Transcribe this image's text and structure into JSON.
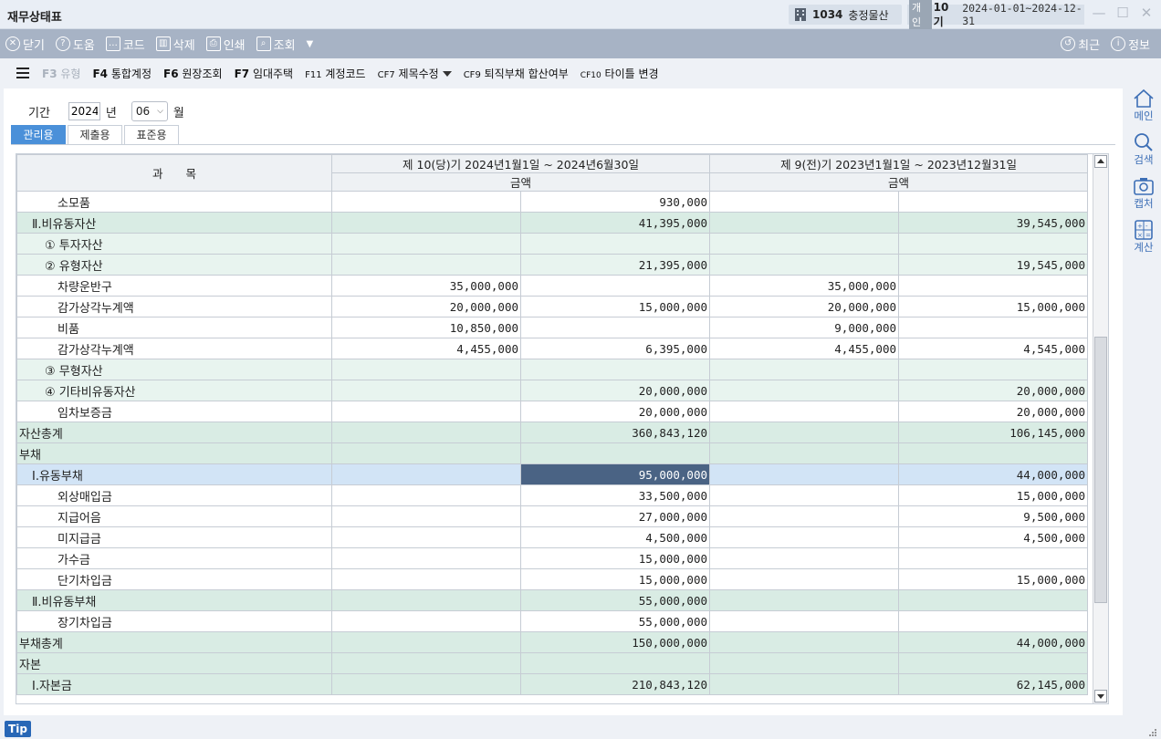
{
  "window": {
    "title": "재무상태표",
    "company_code": "1034",
    "company_name": "충정물산",
    "entity_type": "개인",
    "term": "10기",
    "period_range": "2024-01-01~2024-12-31"
  },
  "toolbar": {
    "close": "닫기",
    "help": "도움",
    "code": "코드",
    "delete": "삭제",
    "print": "인쇄",
    "query": "조회",
    "recent": "최근",
    "info": "정보"
  },
  "fkeys": {
    "f3_key": "F3",
    "f3_label": "유형",
    "f4_key": "F4",
    "f4_label": "통합계정",
    "f6_key": "F6",
    "f6_label": "원장조회",
    "f7_key": "F7",
    "f7_label": "임대주택",
    "f11_key": "F11",
    "f11_label": "계정코드",
    "cf7_key": "CF7",
    "cf7_label": "제목수정",
    "cf9_key": "CF9",
    "cf9_label": "퇴직부채 합산여부",
    "cf10_key": "CF10",
    "cf10_label": "타이틀 변경"
  },
  "filter": {
    "period_label": "기간",
    "year": "2024",
    "year_unit": "년",
    "month": "06",
    "month_unit": "월"
  },
  "tabs": [
    "관리용",
    "제출용",
    "표준용"
  ],
  "table": {
    "header_subject": "과　　목",
    "header_current": "제 10(당)기 2024년1월1일 ~ 2024년6월30일",
    "header_prior": "제 9(전)기 2023년1월1일 ~ 2023년12월31일",
    "amount_label_current": "금액",
    "amount_label_prior": "금액",
    "rows": [
      {
        "label": "소모품",
        "c1": "",
        "c2": "930,000",
        "p1": "",
        "p2": ""
      },
      {
        "label": "Ⅱ.비유동자산",
        "c1": "",
        "c2": "41,395,000",
        "p1": "",
        "p2": "39,545,000"
      },
      {
        "label": "① 투자자산",
        "c1": "",
        "c2": "",
        "p1": "",
        "p2": ""
      },
      {
        "label": "② 유형자산",
        "c1": "",
        "c2": "21,395,000",
        "p1": "",
        "p2": "19,545,000"
      },
      {
        "label": "차량운반구",
        "c1": "35,000,000",
        "c2": "",
        "p1": "35,000,000",
        "p2": ""
      },
      {
        "label": "감가상각누계액",
        "c1": "20,000,000",
        "c2": "15,000,000",
        "p1": "20,000,000",
        "p2": "15,000,000"
      },
      {
        "label": "비품",
        "c1": "10,850,000",
        "c2": "",
        "p1": "9,000,000",
        "p2": ""
      },
      {
        "label": "감가상각누계액",
        "c1": "4,455,000",
        "c2": "6,395,000",
        "p1": "4,455,000",
        "p2": "4,545,000"
      },
      {
        "label": "③ 무형자산",
        "c1": "",
        "c2": "",
        "p1": "",
        "p2": ""
      },
      {
        "label": "④ 기타비유동자산",
        "c1": "",
        "c2": "20,000,000",
        "p1": "",
        "p2": "20,000,000"
      },
      {
        "label": "임차보증금",
        "c1": "",
        "c2": "20,000,000",
        "p1": "",
        "p2": "20,000,000"
      },
      {
        "label": "자산총계",
        "c1": "",
        "c2": "360,843,120",
        "p1": "",
        "p2": "106,145,000"
      },
      {
        "label": "부채",
        "c1": "",
        "c2": "",
        "p1": "",
        "p2": ""
      },
      {
        "label": "Ⅰ.유동부채",
        "c1": "",
        "c2": "95,000,000",
        "p1": "",
        "p2": "44,000,000"
      },
      {
        "label": "외상매입금",
        "c1": "",
        "c2": "33,500,000",
        "p1": "",
        "p2": "15,000,000"
      },
      {
        "label": "지급어음",
        "c1": "",
        "c2": "27,000,000",
        "p1": "",
        "p2": "9,500,000"
      },
      {
        "label": "미지급금",
        "c1": "",
        "c2": "4,500,000",
        "p1": "",
        "p2": "4,500,000"
      },
      {
        "label": "가수금",
        "c1": "",
        "c2": "15,000,000",
        "p1": "",
        "p2": ""
      },
      {
        "label": "단기차입금",
        "c1": "",
        "c2": "15,000,000",
        "p1": "",
        "p2": "15,000,000"
      },
      {
        "label": "Ⅱ.비유동부채",
        "c1": "",
        "c2": "55,000,000",
        "p1": "",
        "p2": ""
      },
      {
        "label": "장기차입금",
        "c1": "",
        "c2": "55,000,000",
        "p1": "",
        "p2": ""
      },
      {
        "label": "부채총계",
        "c1": "",
        "c2": "150,000,000",
        "p1": "",
        "p2": "44,000,000"
      },
      {
        "label": "자본",
        "c1": "",
        "c2": "",
        "p1": "",
        "p2": ""
      },
      {
        "label": "Ⅰ.자본금",
        "c1": "",
        "c2": "210,843,120",
        "p1": "",
        "p2": "62,145,000"
      }
    ]
  },
  "sidebar": {
    "main": "메인",
    "search": "검색",
    "capture": "캡처",
    "calc": "계산"
  },
  "status": {
    "tip": "Tip"
  },
  "colors": {
    "toolbar_bg": "#a7b3c5",
    "group_row": "#d9ece4",
    "selected_row": "#d2e4f6",
    "selected_cell": "#4a6384",
    "accent": "#3d6fb6"
  }
}
